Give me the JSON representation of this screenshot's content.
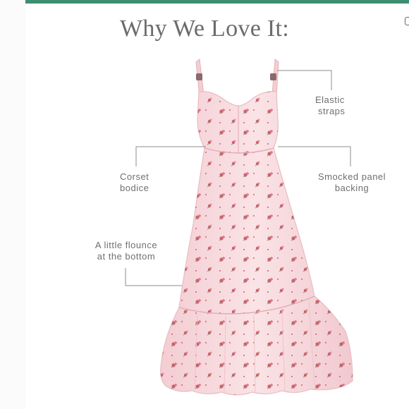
{
  "title": "Why We Love It:",
  "callouts": {
    "elastic_straps": {
      "line1": "Elastic",
      "line2": "straps"
    },
    "corset_bodice": {
      "line1": "Corset",
      "line2": "bodice"
    },
    "smocked_panel": {
      "line1": "Smocked panel",
      "line2": "backing"
    },
    "flounce": {
      "line1": "A little flounce",
      "line2": "at the bottom"
    }
  },
  "colors": {
    "accent_band": "#3e8e6f",
    "text": "#6f6f6f",
    "dress_fabric": "#f8d9dc",
    "floral": "#c84a5a",
    "leaf": "#5e8a4e"
  }
}
